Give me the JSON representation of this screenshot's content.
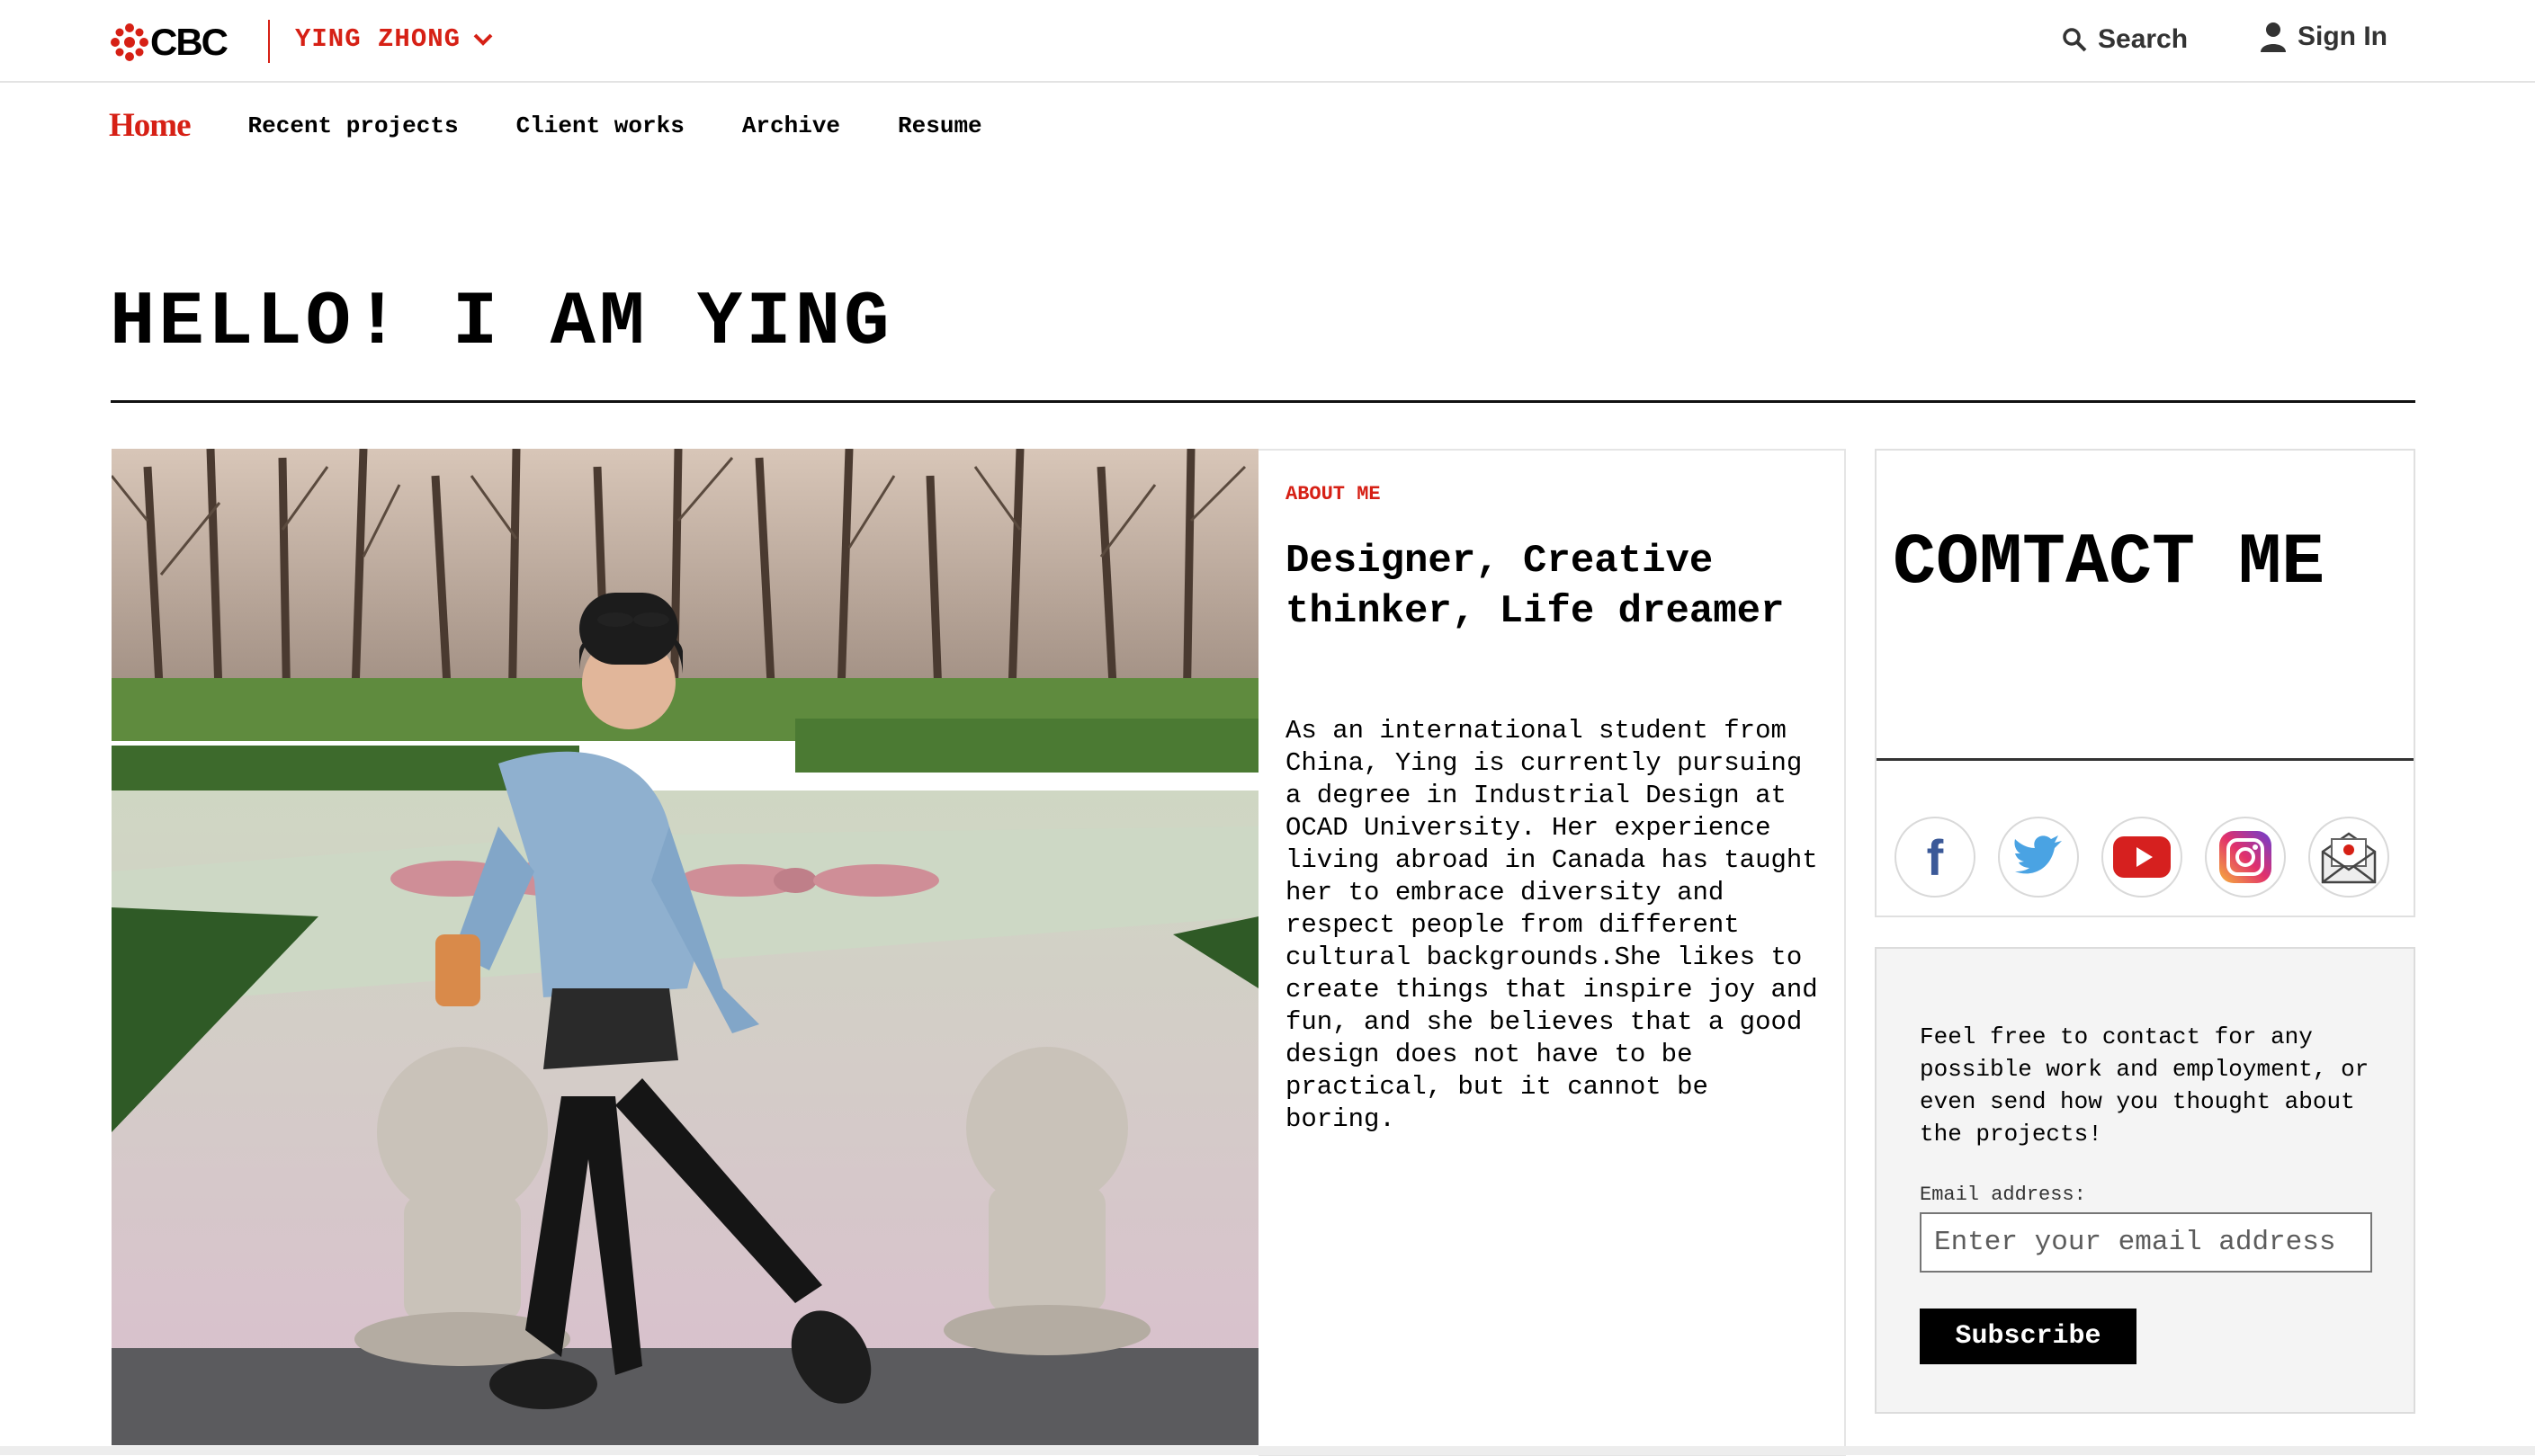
{
  "brand": {
    "logo_text": "CBC",
    "site_name": "YING ZHONG",
    "accent_color": "#d62015"
  },
  "header": {
    "search_label": "Search",
    "signin_label": "Sign In"
  },
  "nav": {
    "home": "Home",
    "items": [
      {
        "label": "Recent projects"
      },
      {
        "label": "Client works"
      },
      {
        "label": "Archive"
      },
      {
        "label": "Resume"
      }
    ]
  },
  "hero": {
    "title": "HELLO! I AM YING"
  },
  "about": {
    "kicker": "ABOUT ME",
    "heading": "Designer, Creative thinker, Life dreamer",
    "body": "As an international student from China, Ying is currently pursuing a degree in Industrial Design at OCAD University. Her experience living abroad in Canada has taught her to embrace diversity and respect people from different cultural backgrounds.She likes to create things that inspire joy and fun, and she believes that a good design does not have to be practical, but it cannot be boring."
  },
  "contact": {
    "title": "COMTACT ME",
    "socials": [
      {
        "icon": "facebook-icon",
        "color": "#3b5998"
      },
      {
        "icon": "twitter-icon",
        "color": "#4aa3e3"
      },
      {
        "icon": "youtube-icon",
        "color": "#d6201f"
      },
      {
        "icon": "instagram-icon",
        "color": "#c13584"
      },
      {
        "icon": "mail-icon",
        "color": "#d62015"
      }
    ]
  },
  "newsletter": {
    "text": "Feel free to contact for any possible work and employment, or even send how you thought about the projects!",
    "email_label": "Email address:",
    "email_placeholder": "Enter your email address",
    "email_value": "",
    "subscribe_label": "Subscribe"
  }
}
